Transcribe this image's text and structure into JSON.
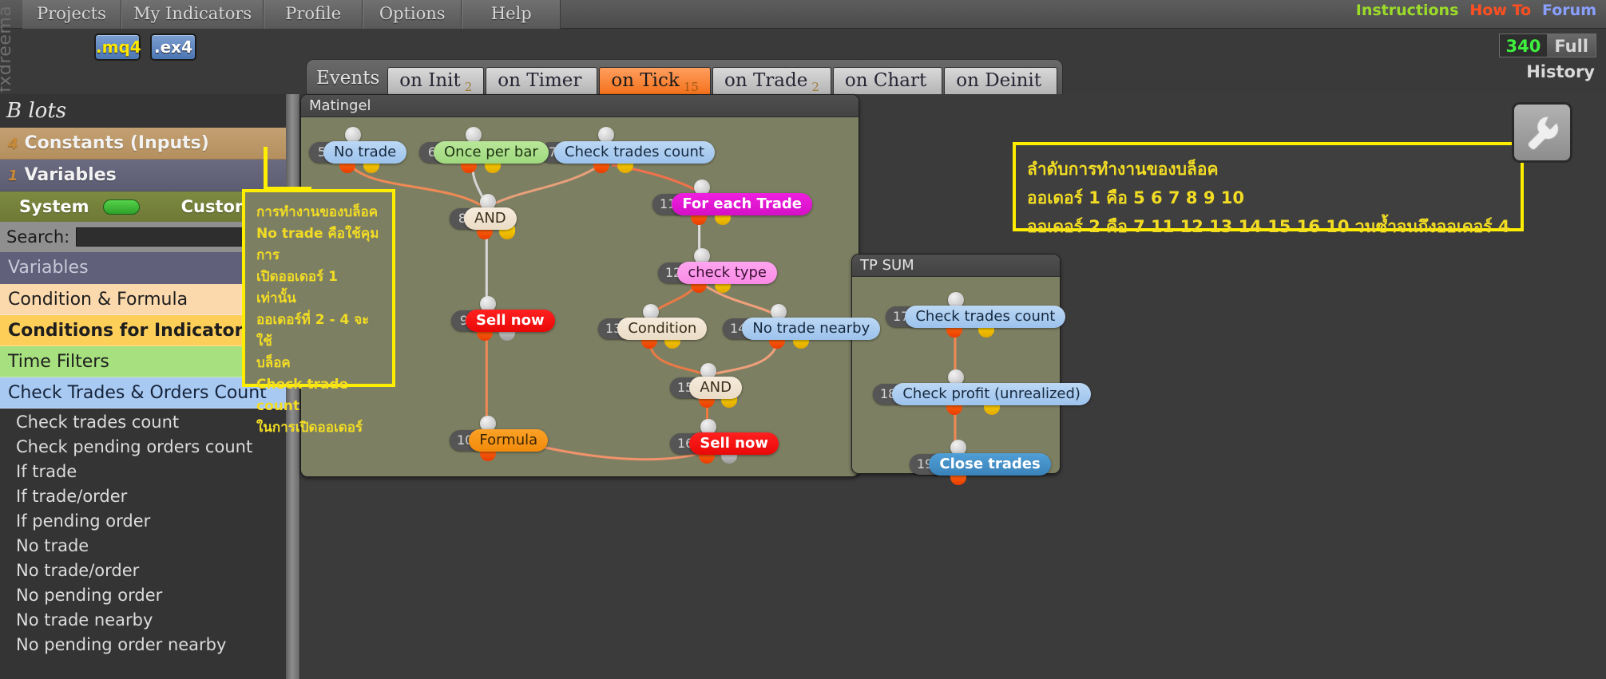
{
  "app": {
    "vertical_label": "fxdreema"
  },
  "menu": {
    "items": [
      {
        "label": "Projects"
      },
      {
        "label": "My Indicators"
      },
      {
        "label": "Profile"
      },
      {
        "label": "Options"
      },
      {
        "label": "Help"
      }
    ]
  },
  "toplinks": {
    "instructions": "Instructions",
    "howto": "How To",
    "forum": "Forum"
  },
  "counter": {
    "number": "340",
    "mode": "Full",
    "history_label": "History"
  },
  "format_buttons": [
    {
      "label": ".mq4"
    },
    {
      "label": ".ex4"
    }
  ],
  "sidebar": {
    "title": "B lots",
    "constants": {
      "count": "4",
      "label": "Constants (Inputs)"
    },
    "variables": {
      "count": "1",
      "label": "Variables"
    },
    "system_row": {
      "system_label": "System",
      "custom_label": "Custom"
    },
    "search": {
      "label": "Search:",
      "value": "",
      "placeholder": ""
    },
    "variables_header": "Variables",
    "categories": [
      {
        "label": "Condition & Formula"
      },
      {
        "label": "Conditions for Indicators"
      },
      {
        "label": "Time Filters"
      },
      {
        "label": "Check Trades & Orders Count"
      }
    ],
    "sublist": [
      "Check trades count",
      "Check pending orders count",
      "If trade",
      "If trade/order",
      "If pending order",
      "No trade",
      "No trade/order",
      "No pending order",
      "No trade nearby",
      "No pending order nearby"
    ]
  },
  "events": {
    "label": "Events",
    "tabs": [
      {
        "label": "on Init",
        "count": "2",
        "active": false
      },
      {
        "label": "on Timer",
        "count": "",
        "active": false
      },
      {
        "label": "on Tick",
        "count": "15",
        "active": true
      },
      {
        "label": "on Trade",
        "count": "2",
        "active": false
      },
      {
        "label": "on Chart",
        "count": "",
        "active": false
      },
      {
        "label": "on Deinit",
        "count": "",
        "active": false
      }
    ]
  },
  "canvas": {
    "groups": [
      {
        "name": "main",
        "title": "Matingel"
      },
      {
        "name": "tpsum",
        "title": "TP SUM"
      }
    ],
    "nodes": [
      {
        "id": "5",
        "label": "No trade",
        "style": "p-blue"
      },
      {
        "id": "6",
        "label": "Once per bar",
        "style": "p-green"
      },
      {
        "id": "7",
        "label": "Check trades count",
        "style": "p-blue"
      },
      {
        "id": "8",
        "label": "AND",
        "style": "p-cream"
      },
      {
        "id": "9",
        "label": "Sell now",
        "style": "p-red"
      },
      {
        "id": "10",
        "label": "Formula",
        "style": "p-orange"
      },
      {
        "id": "11",
        "label": "For each Trade",
        "style": "p-magenta"
      },
      {
        "id": "12",
        "label": "check type",
        "style": "p-pink"
      },
      {
        "id": "13",
        "label": "Condition",
        "style": "p-cream"
      },
      {
        "id": "14",
        "label": "No trade nearby",
        "style": "p-blue"
      },
      {
        "id": "15",
        "label": "AND",
        "style": "p-cream"
      },
      {
        "id": "16",
        "label": "Sell now",
        "style": "p-red"
      },
      {
        "id": "17",
        "label": "Check trades count",
        "style": "p-blue"
      },
      {
        "id": "18",
        "label": "Check profit (unrealized)",
        "style": "p-blue"
      },
      {
        "id": "19",
        "label": "Close trades",
        "style": "p-steel"
      }
    ]
  },
  "notes": {
    "left": {
      "lines": [
        "การทำงานของบล็อค",
        "No trade คือใช้คุมการ",
        "เปิดออเดอร์ 1 เท่านั้น",
        "ออเดอร์ที่ 2 - 4 จะใช้",
        "บล็อค",
        "Check trade count",
        "ในการเปิดออเดอร์"
      ]
    },
    "right": {
      "lines": [
        "ลำดับการทำงานของบล็อค",
        "ออเดอร์ 1 คือ 5 6 7 8 9 10",
        "ออเดอร์ 2 คือ 7 11 12 13 14 15 16 10  วนซ้ำจนถึงออเดอร์ 4"
      ]
    }
  },
  "icons": {
    "wrench": "wrench-icon"
  },
  "colors": {
    "accent_orange": "#f4721c",
    "note_yellow": "#ffee00",
    "canvas_group": "#7d7f63",
    "link_orange": "#ef6a24"
  }
}
